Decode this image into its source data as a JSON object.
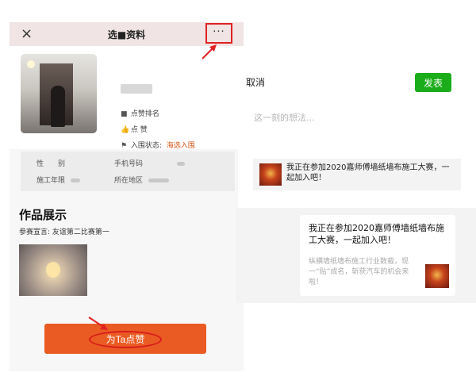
{
  "profile_page": {
    "close_icon": "×",
    "title": "选■资料",
    "more_icon": "···",
    "stats": {
      "row1_icon": "■",
      "row1_text": "点赞排名",
      "row2_icon": "👍",
      "row2_text": "点 赞",
      "row3_icon": "⚑",
      "row3_label": "入围状态:",
      "row3_value": "海选入围"
    },
    "info": {
      "gender_label": "性　　别",
      "phone_label": "手机号码",
      "years_label": "施工年限",
      "region_label": "所在地区"
    },
    "works_title": "作品展示",
    "declaration": "参赛宣言: 友谊第二比赛第一",
    "vote_button": "为Ta点赞"
  },
  "share_page": {
    "cancel": "取消",
    "publish": "发表",
    "placeholder": "这一刻的想法...",
    "card_text": "我正在参加2020嘉师傅墙纸墙布施工大赛，一起加入吧！"
  },
  "chat_bubble": {
    "title": "我正在参加2020嘉师傅墙纸墙布施工大赛，一起加入吧！",
    "desc": "纵横墙纸墙布施工行业数载，现一“贴”成名，斩获汽车的机会来啦！"
  },
  "colors": {
    "accent_orange": "#ea5b23",
    "highlight_red": "#e02222",
    "wechat_green": "#1aad19",
    "status_orange": "#d4571c"
  }
}
